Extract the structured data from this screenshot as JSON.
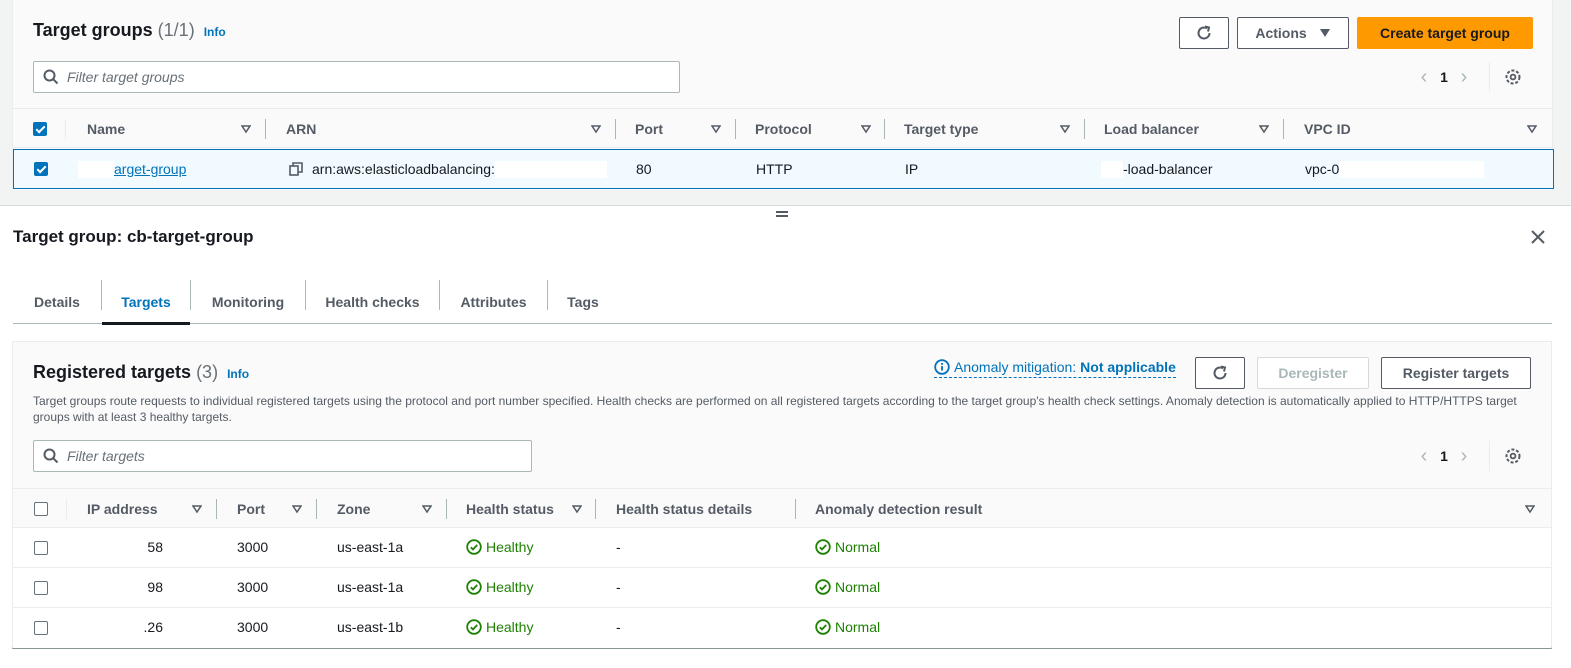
{
  "target_groups": {
    "title": "Target groups",
    "count": "(1/1)",
    "info": "Info",
    "actions_label": "Actions",
    "create_label": "Create target group",
    "filter_placeholder": "Filter target groups",
    "page": "1",
    "columns": [
      "Name",
      "ARN",
      "Port",
      "Protocol",
      "Target type",
      "Load balancer",
      "VPC ID"
    ],
    "rows": [
      {
        "selected": true,
        "name": "arget-group",
        "arn": "arn:aws:elasticloadbalancing:",
        "port": "80",
        "protocol": "HTTP",
        "target_type": "IP",
        "load_balancer": "-load-balancer",
        "vpc_id": "vpc-0"
      }
    ]
  },
  "details": {
    "title": "Target group: cb-target-group",
    "tabs": [
      "Details",
      "Targets",
      "Monitoring",
      "Health checks",
      "Attributes",
      "Tags"
    ],
    "active_tab": "Targets"
  },
  "registered_targets": {
    "title": "Registered targets",
    "count": "(3)",
    "info": "Info",
    "anomaly_label": "Anomaly mitigation:",
    "anomaly_value": "Not applicable",
    "deregister_label": "Deregister",
    "register_label": "Register targets",
    "description": "Target groups route requests to individual registered targets using the protocol and port number specified. Health checks are performed on all registered targets according to the target group's health check settings. Anomaly detection is automatically applied to HTTP/HTTPS target groups with at least 3 healthy targets.",
    "filter_placeholder": "Filter targets",
    "page": "1",
    "columns": [
      "IP address",
      "Port",
      "Zone",
      "Health status",
      "Health status details",
      "Anomaly detection result"
    ],
    "rows": [
      {
        "ip": "58",
        "port": "3000",
        "zone": "us-east-1a",
        "health": "Healthy",
        "details": "-",
        "anomaly": "Normal"
      },
      {
        "ip": "98",
        "port": "3000",
        "zone": "us-east-1a",
        "health": "Healthy",
        "details": "-",
        "anomaly": "Normal"
      },
      {
        "ip": ".26",
        "port": "3000",
        "zone": "us-east-1b",
        "health": "Healthy",
        "details": "-",
        "anomaly": "Normal"
      }
    ]
  },
  "colors": {
    "primary": "#ff9900",
    "link": "#0073bb",
    "healthy": "#1d8102"
  }
}
